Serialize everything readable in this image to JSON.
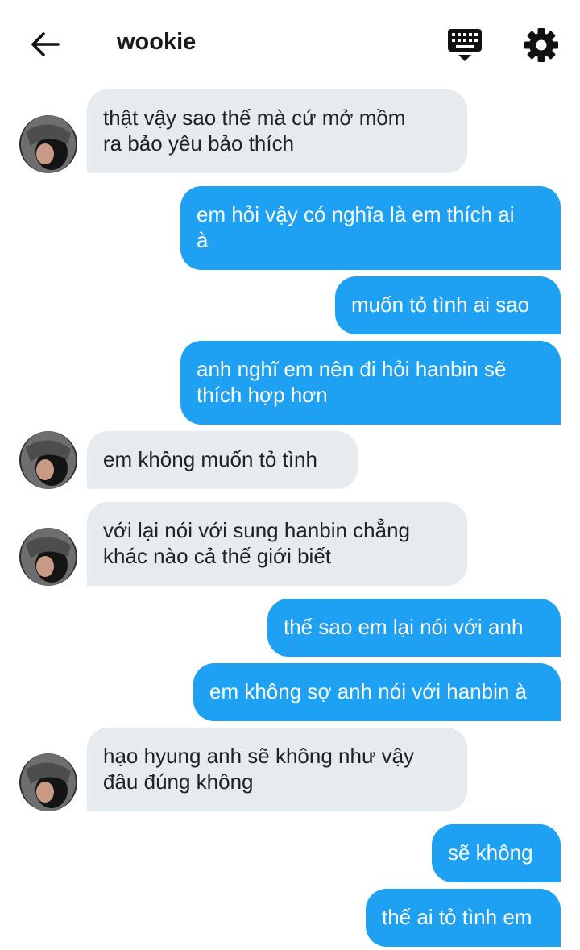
{
  "header": {
    "title": "wookie",
    "back_icon": "arrow-left-icon",
    "keyboard_icon": "keyboard-icon",
    "settings_icon": "gear-icon"
  },
  "colors": {
    "incoming_bubble": "#e6ebef",
    "outgoing_bubble": "#1ea1f2",
    "incoming_text": "#222222",
    "outgoing_text": "#ffffff"
  },
  "messages": [
    {
      "from": "wookie",
      "lines": [
        "thật vậy sao thế mà cứ mở mồm",
        "ra bảo yêu bảo thích"
      ]
    },
    {
      "from": "me",
      "lines": [
        "em hỏi vậy có nghĩa là em thích ai",
        "à"
      ]
    },
    {
      "from": "me",
      "lines": [
        "muốn tỏ tình ai sao"
      ]
    },
    {
      "from": "me",
      "lines": [
        "anh nghĩ em nên đi hỏi hanbin sẽ",
        "thích hợp hơn"
      ]
    },
    {
      "from": "wookie",
      "lines": [
        "em không muốn tỏ tình"
      ]
    },
    {
      "from": "wookie",
      "lines": [
        "với lại nói với sung hanbin chẳng",
        "khác nào cả thế giới biết"
      ]
    },
    {
      "from": "me",
      "lines": [
        "thế sao em lại nói với anh"
      ]
    },
    {
      "from": "me",
      "lines": [
        "em không sợ anh nói với hanbin à"
      ]
    },
    {
      "from": "wookie",
      "lines": [
        "hạo hyung anh sẽ không như vậy",
        "đâu đúng không"
      ]
    },
    {
      "from": "me",
      "lines": [
        "sẽ không"
      ]
    },
    {
      "from": "me",
      "lines": [
        "thế ai tỏ tình em"
      ]
    }
  ]
}
